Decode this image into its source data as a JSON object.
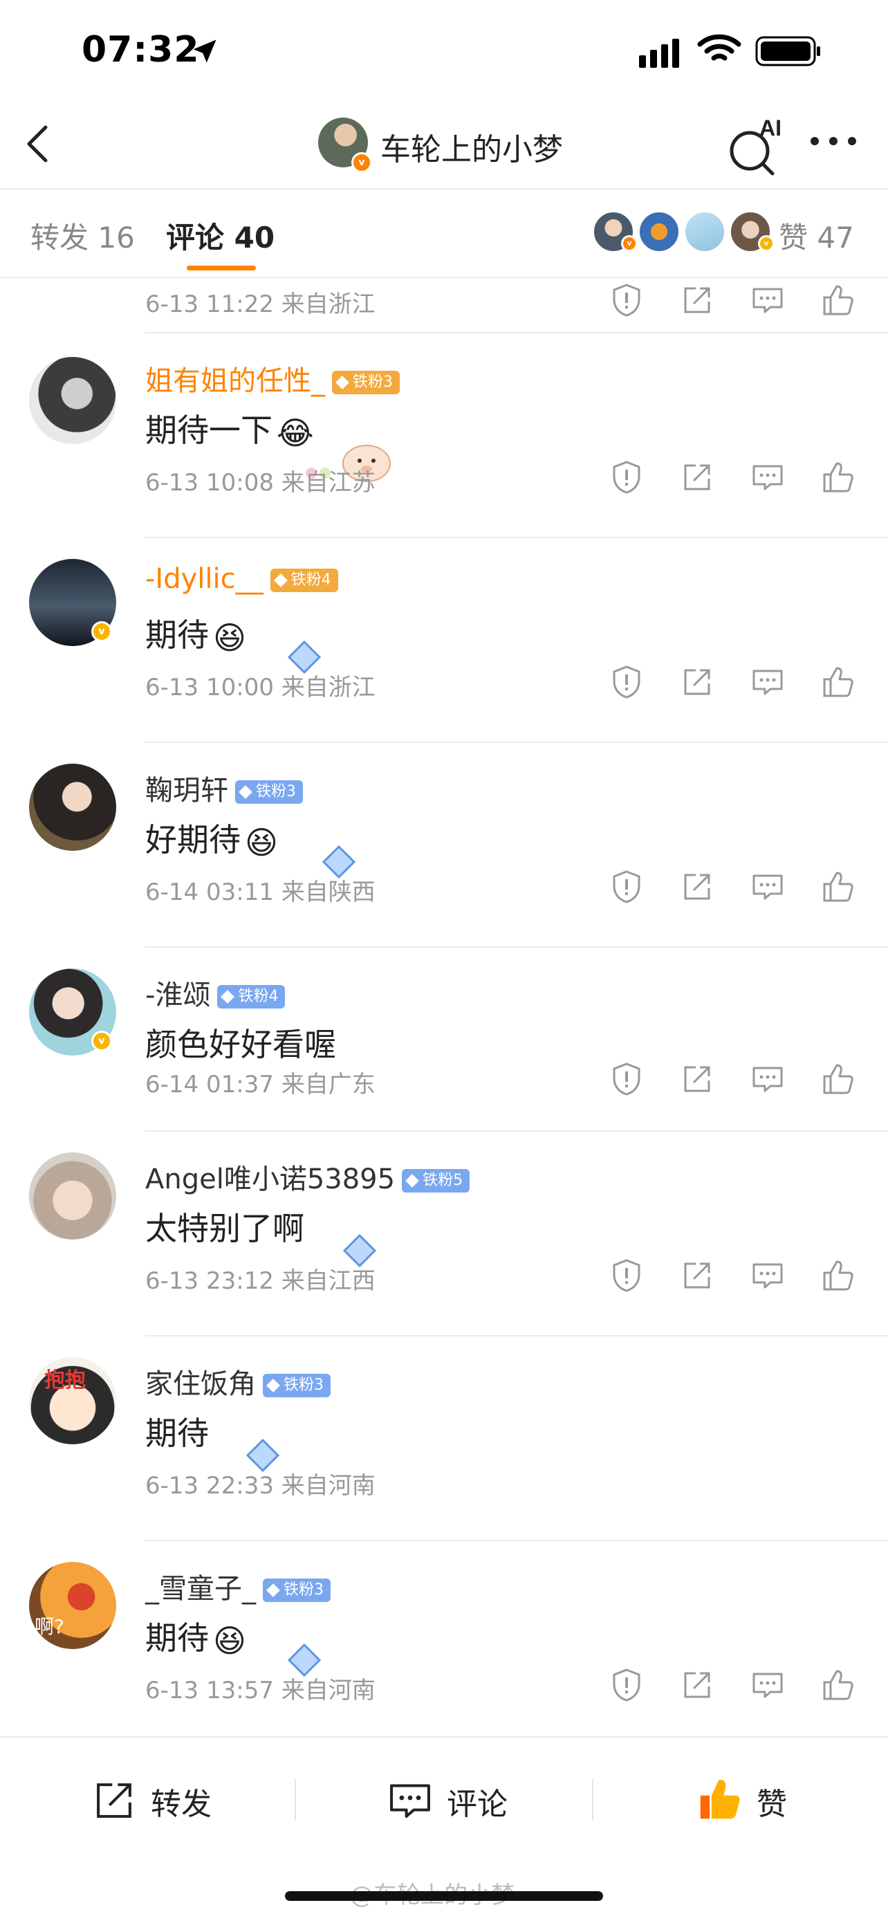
{
  "status": {
    "time": "07:32"
  },
  "nav": {
    "title": "车轮上的小梦",
    "ai_label": "AI"
  },
  "tabs": {
    "repost": "转发 16",
    "comment": "评论 40",
    "likes": "赞 47"
  },
  "comments": [
    {
      "meta": "6-13 11:22 来自浙江"
    },
    {
      "name": "姐有姐的任性_",
      "badge": "铁粉3",
      "text": "期待一下",
      "meta": "6-13 10:08 来自江苏"
    },
    {
      "name": "-Idyllic__",
      "badge": "铁粉4",
      "text": "期待",
      "meta": "6-13 10:00 来自浙江"
    },
    {
      "name": "鞠玥轩",
      "badge": "铁粉3",
      "text": "好期待",
      "meta": "6-14 03:11 来自陕西"
    },
    {
      "name": "-淮颂",
      "badge": "铁粉4",
      "text": "颜色好好看喔",
      "meta": "6-14 01:37 来自广东"
    },
    {
      "name": "Angel唯小诺53895",
      "badge": "铁粉5",
      "text": "太特别了啊",
      "meta": "6-13 23:12 来自江西"
    },
    {
      "name": "家住饭角",
      "badge": "铁粉3",
      "text": "期待",
      "meta": "6-13 22:33 来自河南"
    },
    {
      "name": "_雪童子_",
      "badge": "铁粉3",
      "text": "期待",
      "meta": "6-13 13:57 来自河南"
    }
  ],
  "avatar_texts": {
    "c7": "抱抱",
    "c8": "啊?"
  },
  "bottom": {
    "repost": "转发",
    "comment": "评论",
    "like": "赞"
  },
  "watermark": "@车轮上的小梦",
  "colors": {
    "accent": "#ff8200",
    "fan_badge": "#7aa7f0",
    "meta": "#999999"
  }
}
